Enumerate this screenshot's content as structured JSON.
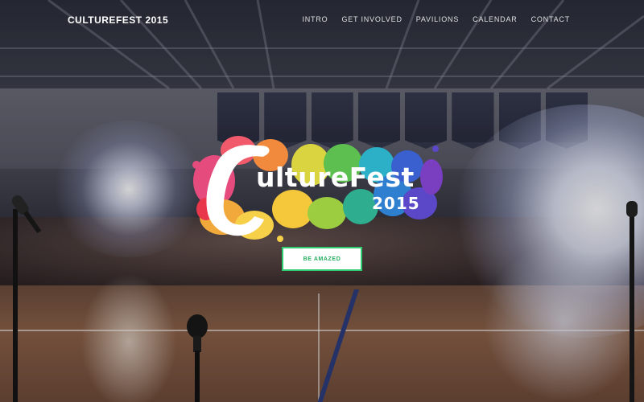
{
  "nav": {
    "brand": "CULTUREFEST 2015",
    "items": [
      {
        "label": "INTRO"
      },
      {
        "label": "GET INVOLVED"
      },
      {
        "label": "PAVILIONS"
      },
      {
        "label": "CALENDAR"
      },
      {
        "label": "CONTACT"
      }
    ]
  },
  "hero": {
    "logo_word": "ultureFest",
    "logo_year": "2015",
    "cta_label": "BE AMAZED",
    "cta_color": "#2ecc71"
  },
  "icons": [
    "hand-c-logo-icon",
    "microphone-icon"
  ]
}
